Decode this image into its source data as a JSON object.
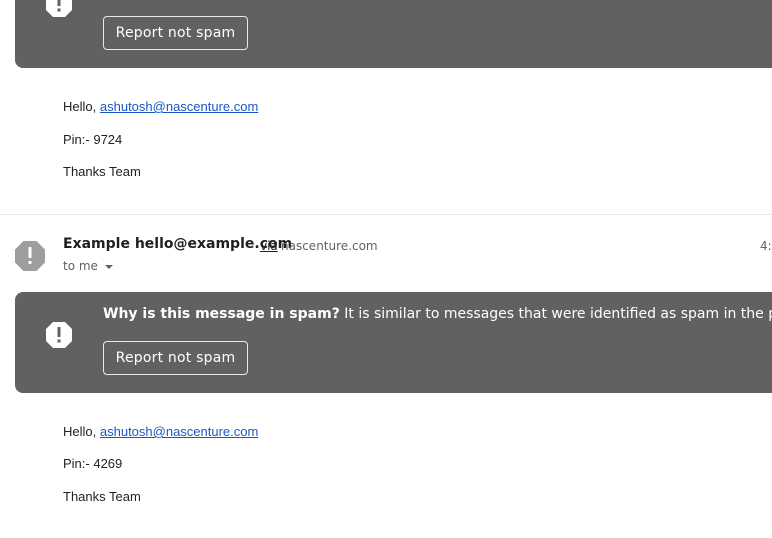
{
  "message1": {
    "report_label": "Report not spam",
    "greeting": "Hello,",
    "email": "ashutosh@nascenture.com",
    "pin": "Pin:- 9724",
    "signoff": "Thanks Team"
  },
  "message2": {
    "sender_name": "Example hello@example.com",
    "via": "via",
    "via_domain": "nascenture.com",
    "time": "4:",
    "to_me": "to me",
    "spam_question": "Why is this message in spam?",
    "spam_explanation": "It is similar to messages that were identified as spam in the past.",
    "report_label": "Report not spam",
    "greeting": "Hello,",
    "email": "ashutosh@nascenture.com",
    "pin": "Pin:- 4269",
    "signoff": "Thanks Team"
  },
  "colors": {
    "banner_bg": "#616161",
    "link": "#1a57c4",
    "avatar_grey": "#9e9e9e"
  },
  "icons": [
    "spam-warning-icon",
    "sender-avatar-icon",
    "chevron-down-icon"
  ]
}
